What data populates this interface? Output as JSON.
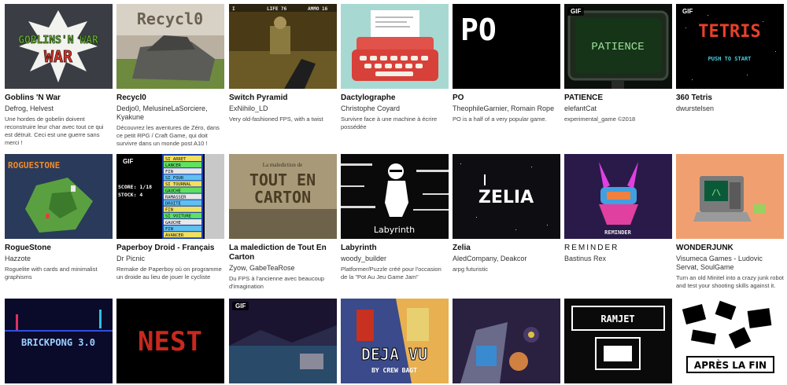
{
  "games": [
    {
      "title": "Goblins 'N War",
      "authors": "Defrog, Helvest",
      "description": "Une hordes de gobelin doivent reconstruire leur char avec tout ce qui est détruit. Ceci est une guerre sans merci !",
      "thumb_text": "GOBLINS'N WAR",
      "gif": false
    },
    {
      "title": "Recycl0",
      "authors": "Dedjo0, MelusineLaSorciere, Kyakune",
      "description": "Découvrez les aventures de Zéro, dans ce petit RPG / Craft Game, qui doit survivre dans un monde post A10 !",
      "thumb_text": "Recycl0",
      "gif": false
    },
    {
      "title": "Switch Pyramid",
      "authors": "ExNihilo_LD",
      "description": "Very old-fashioned FPS, with a twist",
      "thumb_text": "LIFE 76",
      "thumb_text2": "AMMO 16",
      "gif": false
    },
    {
      "title": "Dactylographe",
      "authors": "Christophe Coyard",
      "description": "Survivre face à une machine à écrire possédée",
      "gif": false
    },
    {
      "title": "PO",
      "authors": "TheophileGarnier, Romain Rope",
      "description": "PO is a half of a very popular game.",
      "thumb_text": "PO",
      "gif": false
    },
    {
      "title": "PATIENCE",
      "authors": "elefantCat",
      "description": "experimental_game ©2018",
      "thumb_text": "PATIENCE",
      "gif": true
    },
    {
      "title": "360 Tetris",
      "authors": "dwurstelsen",
      "description": "",
      "thumb_text": "TETRIS",
      "thumb_text2": "PUSH  TO START",
      "gif": true
    },
    {
      "title": "RogueStone",
      "authors": "Hazzote",
      "description": "Roguelite with cards and minimalist graphisms",
      "thumb_text": "ROGUESTONE",
      "gif": false
    },
    {
      "title": "Paperboy Droid - Français",
      "authors": "Dr Picnic",
      "description": "Remake de Paperboy où on programme un droide au lieu de jouer le cycliste",
      "thumb_text": "SCORE: 1/18",
      "thumb_text2": "STOCK: 4",
      "thumb_list": [
        "SI ARRET",
        "LANCER",
        "FIN",
        "SI FOUR",
        "SI TOURNAL",
        "GAUCHE",
        "RAMASSER",
        "DROITE",
        "FIN",
        "SI VOITURE",
        "GAUCHE",
        "FIN",
        "AVANCER"
      ],
      "gif": true
    },
    {
      "title": "La malediction de Tout En Carton",
      "authors": "Zyow, GabeTeaRose",
      "description": "Du FPS à l'ancienne avec beaucoup d'imagination",
      "thumb_text": "TOUT EN",
      "thumb_text2": "CARTON",
      "thumb_text3": "La malediction de",
      "gif": false
    },
    {
      "title": "Labyrinth",
      "authors": "woody_builder",
      "description": "Platformer/Puzzle créé pour l'occasion de la \"Pot Au Jeu Game Jam\"",
      "thumb_text": "Labyrinth",
      "gif": false
    },
    {
      "title": "Zelia",
      "authors": "AledCompany, Deakcor",
      "description": "arpg futuristic",
      "thumb_text": "ZELIA",
      "gif": false
    },
    {
      "title": "REMINDER",
      "authors": "Bastinus Rex",
      "description": "",
      "thumb_text": "REMINDER",
      "gif": false
    },
    {
      "title": "WONDERJUNK",
      "authors": "Visumeca Games - Ludovic Servat, SoulGame",
      "description": "Turn an old Minitel into a crazy junk robot and test your shooting skills against it.",
      "gif": false
    },
    {
      "title": "",
      "authors": "",
      "description": "",
      "thumb_text": "BRICKPONG 3.0",
      "gif": false
    },
    {
      "title": "",
      "authors": "",
      "description": "",
      "thumb_text": "NEST",
      "gif": false
    },
    {
      "title": "",
      "authors": "",
      "description": "",
      "gif": true
    },
    {
      "title": "",
      "authors": "",
      "description": "",
      "thumb_text": "DEJA VU",
      "thumb_text2": "BY CREW BAGT",
      "gif": false
    },
    {
      "title": "",
      "authors": "",
      "description": "",
      "gif": false
    },
    {
      "title": "",
      "authors": "",
      "description": "",
      "thumb_text": "RAMJET",
      "gif": false
    },
    {
      "title": "",
      "authors": "",
      "description": "",
      "thumb_text": "APRÈS LA FIN",
      "gif": false
    }
  ],
  "badge_label": "GIF",
  "colors": {
    "title": "#111111",
    "text": "#333333",
    "bg": "#ffffff"
  }
}
